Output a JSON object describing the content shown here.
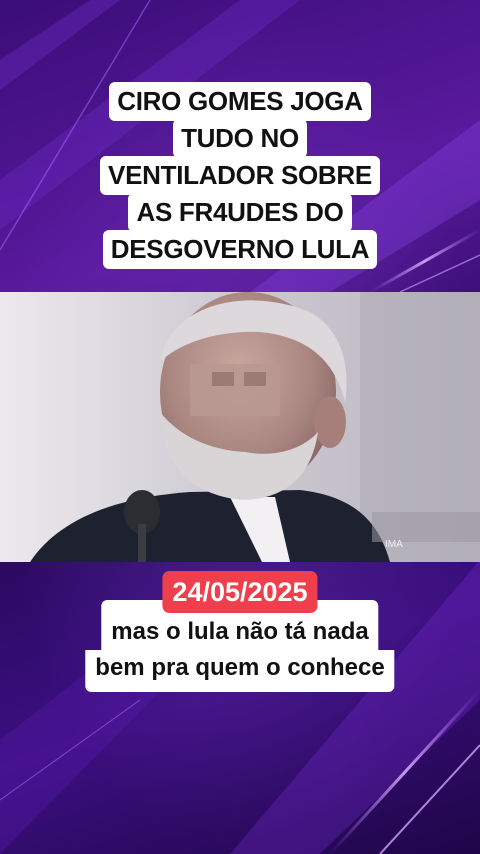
{
  "headline": {
    "lines": [
      "CIRO GOMES JOGA",
      "TUDO NO",
      "VENTILADOR SOBRE",
      "AS FR4UDES DO",
      "DESGOVERNO LULA"
    ]
  },
  "video": {
    "watermark": "IMA"
  },
  "date_badge": "24/05/2025",
  "subtitle": {
    "lines": [
      "mas o lula não tá nada",
      "bem pra quem o conhece"
    ]
  },
  "colors": {
    "background_purple": "#3a0d78",
    "date_badge_red": "#ef3f4c",
    "text_box_white": "#ffffff"
  }
}
